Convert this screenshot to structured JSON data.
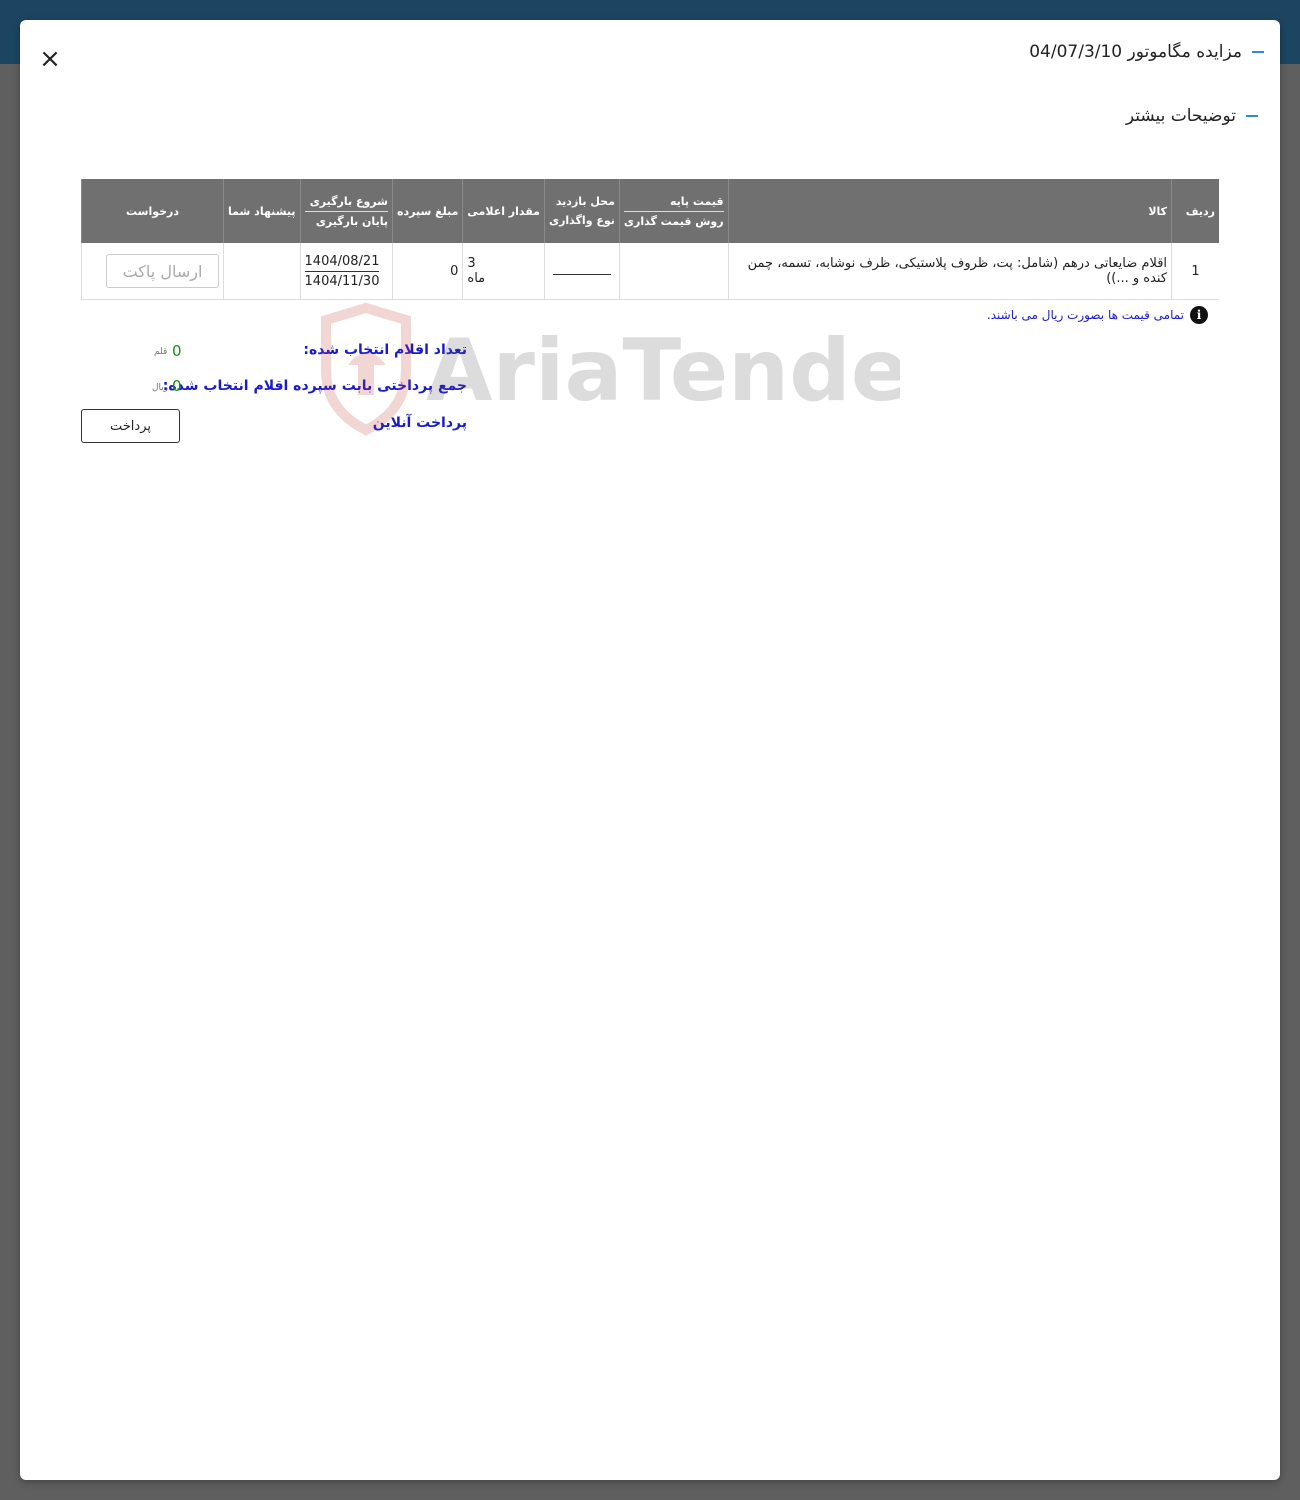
{
  "modal": {
    "title": "مزایده مگاموتور 04/07/3/10",
    "subtitle": "توضیحات بیشتر",
    "close_label": "×"
  },
  "table": {
    "headers": {
      "row": "ردیف",
      "item": "کالا",
      "base_price": "قیمت پایه",
      "pricing_method": "روش قیمت گذاری",
      "visit_location": "محل بازدید",
      "assignment_type": "نوع واگذاری",
      "declared_quantity": "مقدار اعلامی",
      "deposit_amount": "مبلغ سپرده",
      "loading_start": "شروع بارگیری",
      "loading_end": "پایان بارگیری",
      "your_offer": "پیشنهاد شما",
      "request": "درخواست"
    },
    "rows": [
      {
        "row": "1",
        "item": "اقلام ضایعاتی درهم (شامل: پت، ظروف پلاستیکی، ظرف نوشابه، تسمه، چمن کنده و ...))",
        "base_price": "",
        "quantity": "3",
        "quantity_unit": "ماه",
        "deposit": "0",
        "loading_start": "1404/08/21",
        "loading_end": "1404/11/30",
        "your_offer": "",
        "request_button": "ارسال پاکت"
      }
    ]
  },
  "info_note": "تمامی قیمت ها بصورت ریال می باشند.",
  "summary": {
    "selected_count_label": "تعداد اقلام انتخاب شده:",
    "selected_count_value": "0",
    "selected_count_unit": "قلم",
    "deposit_total_label": "جمع پرداختی بابت سپرده اقلام انتخاب شده:",
    "deposit_total_value": "0",
    "deposit_total_unit": "ریال",
    "online_payment_label": "پرداخت آنلاین",
    "pay_button": "پرداخت"
  },
  "watermark": {
    "text": "AriaTender.neT",
    "color": "#c0392b"
  },
  "icons": {
    "close": "close-icon",
    "info": "info-icon"
  }
}
